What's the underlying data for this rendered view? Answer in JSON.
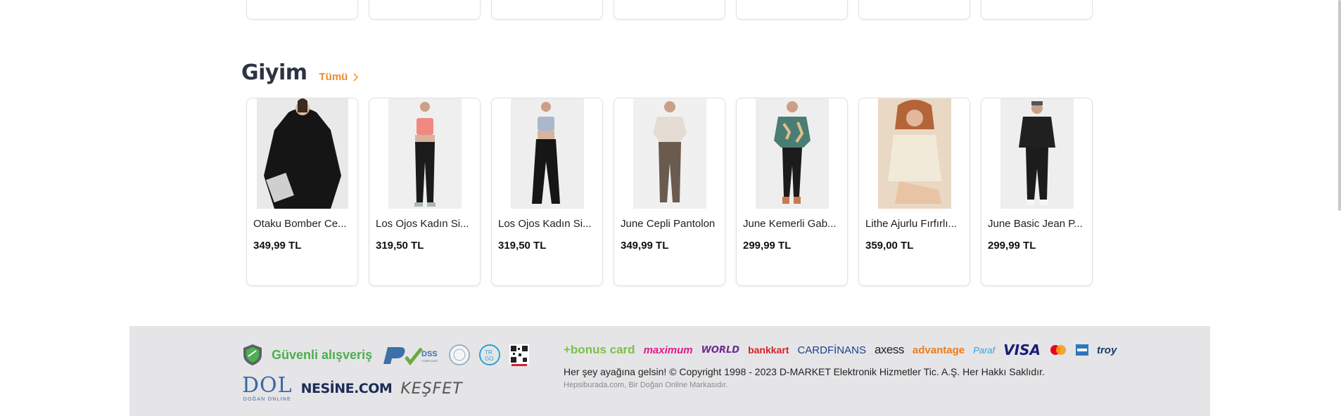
{
  "section": {
    "title": "Giyim",
    "see_all": "Tümü"
  },
  "products": [
    {
      "name": "Otaku Bomber Ce...",
      "price": "349,99 TL"
    },
    {
      "name": "Los Ojos Kadın Si...",
      "price": "319,50 TL"
    },
    {
      "name": "Los Ojos Kadın Si...",
      "price": "319,50 TL"
    },
    {
      "name": "June Cepli Pantolon",
      "price": "349,99 TL"
    },
    {
      "name": "June Kemerli Gab...",
      "price": "299,99 TL"
    },
    {
      "name": "Lithe Ajurlu Fırfırlı...",
      "price": "359,00 TL"
    },
    {
      "name": "June Basic Jean P...",
      "price": "299,99 TL"
    }
  ],
  "footer": {
    "secure_label": "Güvenli alışveriş",
    "pci_label": "PCI",
    "dss_label": "DSS",
    "dog_logo": "DOL",
    "dog_sub": "DOĞAN ONLINE",
    "nesine": "NESİNE.COM",
    "kesfet": "KEŞFET",
    "banks": {
      "bonus": "+bonus card",
      "maximum": "maximum",
      "world": "WORLD",
      "bankkart": "bankkart",
      "cardfinans": "CARDFİNANS",
      "axess": "axess",
      "advantage": "advantage",
      "paraf": "Paraf",
      "visa": "VISA",
      "troy": "troy"
    },
    "copyright": "Her şey ayağına gelsin! © Copyright 1998 - 2023 D-MARKET Elektronik Hizmetler Tic. A.Ş. Her Hakkı Saklıdır.",
    "brand_line": "Hepsiburada.com, Bir Doğan Online Markasıdır."
  },
  "colors": {
    "accent": "#f28b2c",
    "secure_green": "#4caf50",
    "footer_bg": "#e5e5e7",
    "title": "#2c3343"
  }
}
